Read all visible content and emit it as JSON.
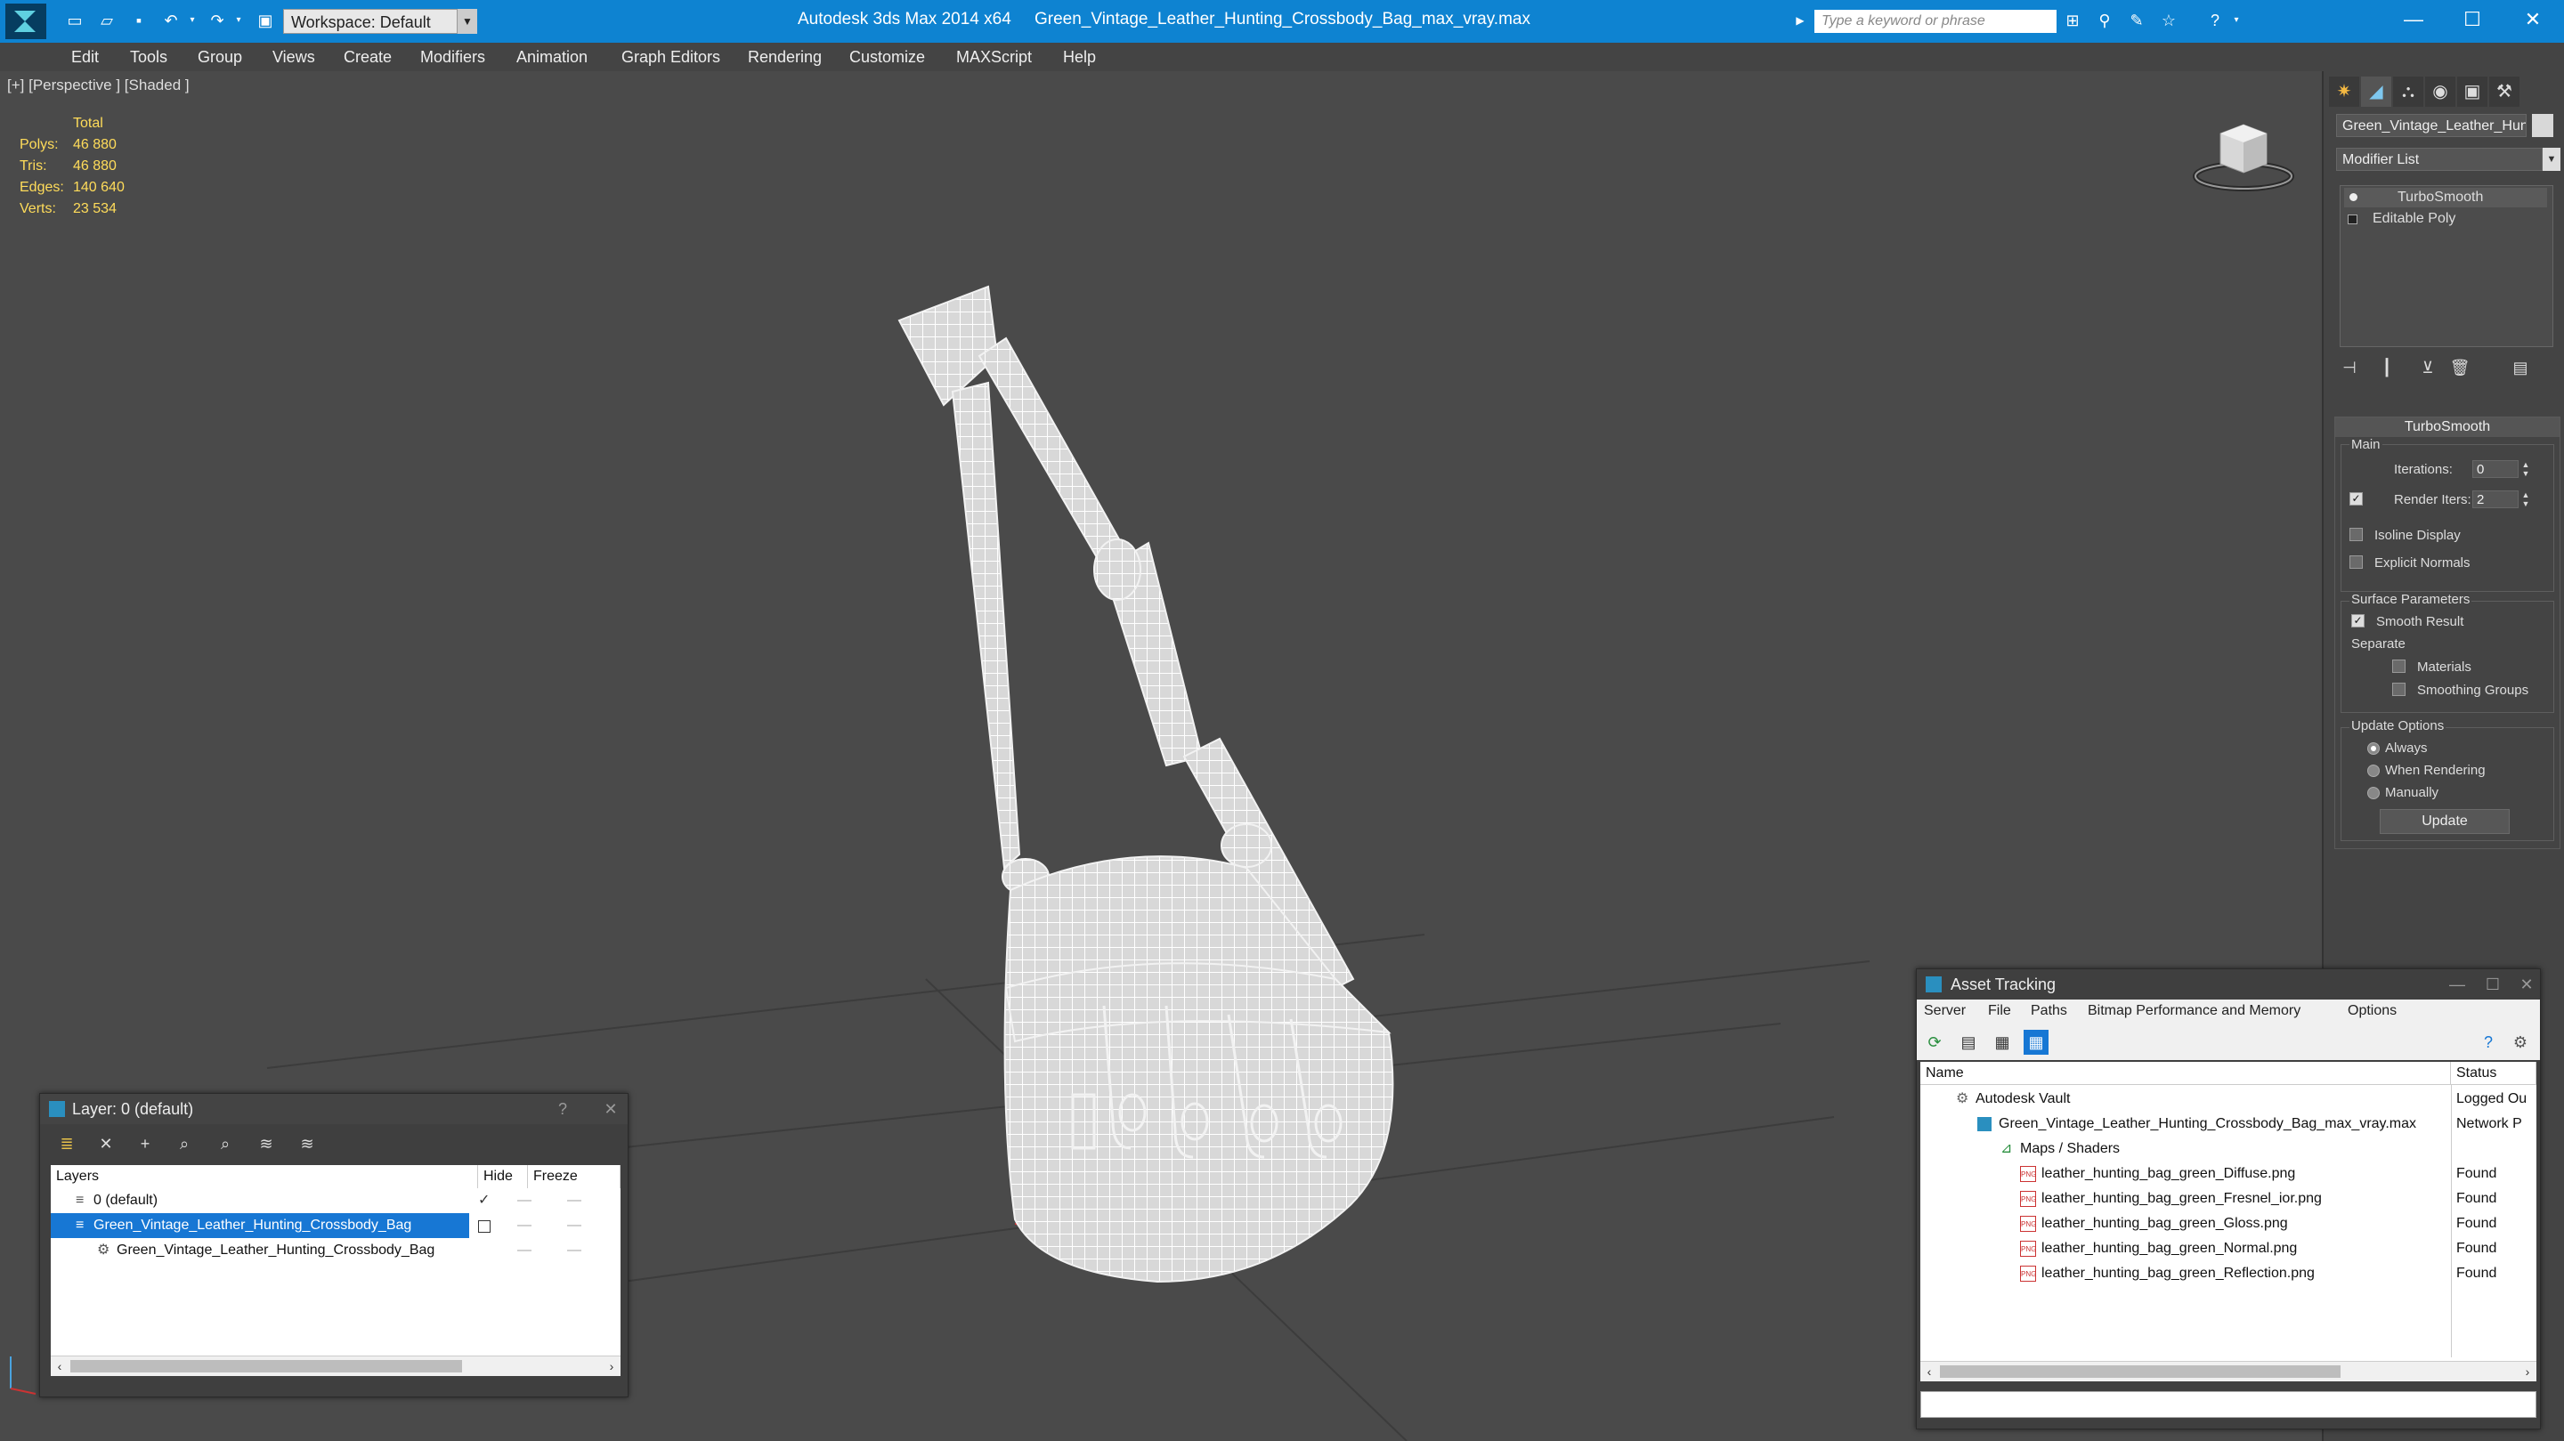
{
  "app": {
    "title": "Autodesk 3ds Max  2014 x64",
    "filename": "Green_Vintage_Leather_Hunting_Crossbody_Bag_max_vray.max",
    "workspace": "Workspace: Default",
    "search_placeholder": "Type a keyword or phrase"
  },
  "menu": [
    "Edit",
    "Tools",
    "Group",
    "Views",
    "Create",
    "Modifiers",
    "Animation",
    "Graph Editors",
    "Rendering",
    "Customize",
    "MAXScript",
    "Help"
  ],
  "viewport": {
    "label": "[+] [Perspective ] [Shaded ]",
    "stats": {
      "header": "Total",
      "polys_label": "Polys:",
      "polys": "46 880",
      "tris_label": "Tris:",
      "tris": "46 880",
      "edges_label": "Edges:",
      "edges": "140 640",
      "verts_label": "Verts:",
      "verts": "23 534"
    }
  },
  "command_panel": {
    "object_name": "Green_Vintage_Leather_Hun",
    "modifier_list": "Modifier List",
    "stack": [
      "TurboSmooth",
      "Editable Poly"
    ],
    "turbosmooth": {
      "title": "TurboSmooth",
      "main_label": "Main",
      "iterations_label": "Iterations:",
      "iterations": "0",
      "render_iters_label": "Render Iters:",
      "render_iters": "2",
      "isoline_label": "Isoline Display",
      "explicit_normals_label": "Explicit Normals",
      "surface_params_label": "Surface Parameters",
      "smooth_result_label": "Smooth Result",
      "separate_label": "Separate",
      "materials_label": "Materials",
      "smoothing_groups_label": "Smoothing Groups",
      "update_options_label": "Update Options",
      "always_label": "Always",
      "when_rendering_label": "When Rendering",
      "manually_label": "Manually",
      "update_button": "Update"
    }
  },
  "layer_window": {
    "title": "Layer: 0 (default)",
    "help": "?",
    "columns": {
      "layers": "Layers",
      "hide": "Hide",
      "freeze": "Freeze"
    },
    "rows": [
      "0 (default)",
      "Green_Vintage_Leather_Hunting_Crossbody_Bag",
      "Green_Vintage_Leather_Hunting_Crossbody_Bag"
    ]
  },
  "asset_window": {
    "title": "Asset Tracking",
    "menu": [
      "Server",
      "File",
      "Paths",
      "Bitmap Performance and Memory",
      "Options"
    ],
    "columns": {
      "name": "Name",
      "status": "Status"
    },
    "rows": [
      {
        "name": "Autodesk Vault",
        "status": "Logged Ou"
      },
      {
        "name": "Green_Vintage_Leather_Hunting_Crossbody_Bag_max_vray.max",
        "status": "Network P"
      },
      {
        "name": "Maps / Shaders",
        "status": ""
      },
      {
        "name": "leather_hunting_bag_green_Diffuse.png",
        "status": "Found"
      },
      {
        "name": "leather_hunting_bag_green_Fresnel_ior.png",
        "status": "Found"
      },
      {
        "name": "leather_hunting_bag_green_Gloss.png",
        "status": "Found"
      },
      {
        "name": "leather_hunting_bag_green_Normal.png",
        "status": "Found"
      },
      {
        "name": "leather_hunting_bag_green_Reflection.png",
        "status": "Found"
      }
    ]
  },
  "colors": {
    "title_bar": "#0e83d1",
    "viewport": "#4a4a4a",
    "selection": "#1777d4",
    "stats": "#ffdc5a"
  }
}
